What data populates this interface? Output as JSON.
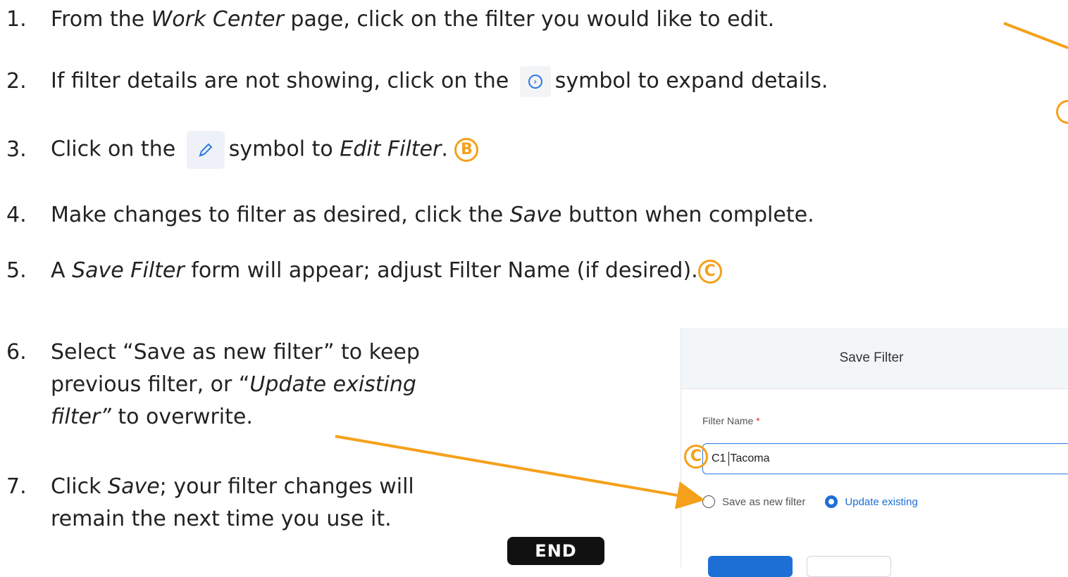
{
  "steps": [
    {
      "num": "1.",
      "parts": [
        "From the ",
        "Work Center",
        " page, click on the filter you would like to edit."
      ]
    },
    {
      "num": "2.",
      "parts": [
        "If filter details are not showing, click on the ",
        "symbol to expand details."
      ]
    },
    {
      "num": "3.",
      "parts": [
        "Click on the ",
        "symbol to ",
        "Edit Filter",
        "."
      ],
      "marker": "B"
    },
    {
      "num": "4.",
      "parts": [
        "Make changes to filter as desired, click the ",
        "Save",
        " button when complete."
      ]
    },
    {
      "num": "5.",
      "parts": [
        "A ",
        "Save Filter",
        " form will appear; adjust Filter Name (if desired)."
      ],
      "marker": "C"
    },
    {
      "num": "6.",
      "parts": [
        "Select “Save as new filter” to keep",
        "previous filter, or “",
        "Update existing",
        "filter”",
        " to overwrite."
      ]
    },
    {
      "num": "7.",
      "parts": [
        "Click ",
        "Save",
        "; your filter changes will",
        "remain the next time you use it."
      ]
    }
  ],
  "icons": {
    "expand": "expand-details-icon",
    "edit": "pencil-edit-icon"
  },
  "dialog": {
    "title": "Save Filter",
    "field_label": "Filter Name",
    "required_mark": "*",
    "field_value_before_caret": "C1",
    "field_value_after_caret": "Tacoma",
    "radio_new": "Save as new filter",
    "radio_update": "Update existing",
    "selected_option": "Update existing"
  },
  "markers": {
    "c_field": "C"
  },
  "end_badge": "END",
  "colors": {
    "accent": "#f5a01a",
    "primary": "#1d6fd6",
    "text": "#222222"
  }
}
